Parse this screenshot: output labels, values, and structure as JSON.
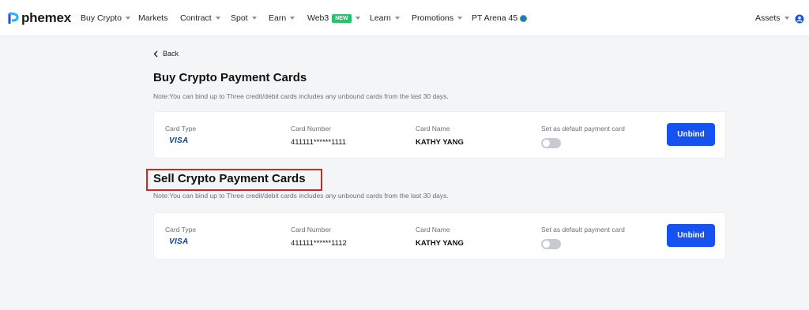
{
  "nav": {
    "logo_text": "phemex",
    "items": [
      {
        "label": "Buy Crypto"
      },
      {
        "label": "Markets"
      },
      {
        "label": "Contract"
      },
      {
        "label": "Spot"
      },
      {
        "label": "Earn"
      },
      {
        "label": "Web3",
        "badge": "NEW"
      },
      {
        "label": "Learn"
      },
      {
        "label": "Promotions"
      },
      {
        "label": "PT Arena 45"
      }
    ],
    "assets_label": "Assets"
  },
  "back_label": "Back",
  "sections": [
    {
      "title": "Buy Crypto Payment Cards",
      "note": "Note:You can bind up to Three credit/debit cards includes any unbound cards from the last 30 days.",
      "card": {
        "type_label": "Card Type",
        "type_value": "VISA",
        "number_label": "Card Number",
        "number_value": "411111******1111",
        "name_label": "Card Name",
        "name_value": "KATHY YANG",
        "default_label": "Set as default payment card",
        "default_on": false,
        "button_label": "Unbind"
      }
    },
    {
      "title": "Sell Crypto Payment Cards",
      "note": "Note:You can bind up to Three credit/debit cards includes any unbound cards from the last 30 days.",
      "card": {
        "type_label": "Card Type",
        "type_value": "VISA",
        "number_label": "Card Number",
        "number_value": "411111******1112",
        "name_label": "Card Name",
        "name_value": "KATHY YANG",
        "default_label": "Set as default payment card",
        "default_on": false,
        "button_label": "Unbind"
      }
    }
  ],
  "colors": {
    "accent": "#1652f0",
    "highlight": "#e02020",
    "new_badge": "#27c26b"
  }
}
